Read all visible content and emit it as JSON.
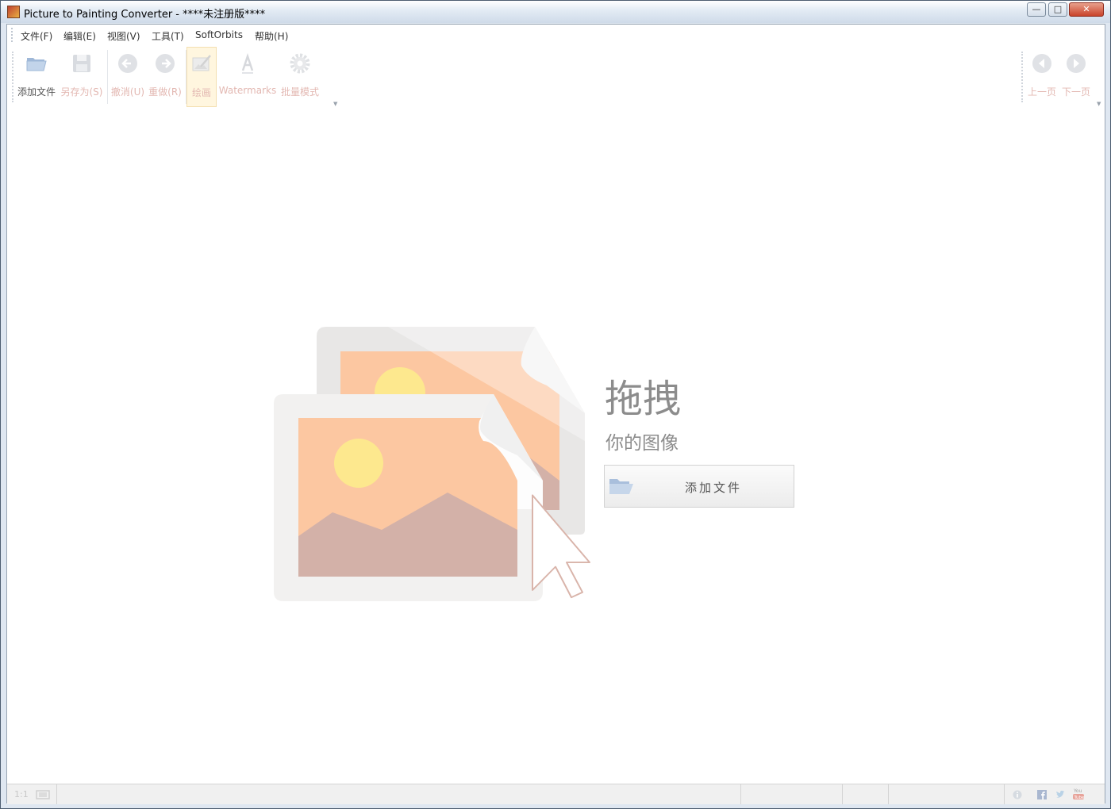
{
  "window": {
    "title": "Picture to Painting Converter - ****未注册版****",
    "buttons": {
      "minimize": "—",
      "maximize": "□",
      "close": "✕"
    }
  },
  "menu": {
    "items": [
      {
        "label": "文件(F)"
      },
      {
        "label": "编辑(E)"
      },
      {
        "label": "视图(V)"
      },
      {
        "label": "工具(T)"
      },
      {
        "label": "SoftOrbits"
      },
      {
        "label": "帮助(H)"
      }
    ]
  },
  "toolbar": {
    "add_file": "添加文件",
    "save_as": "另存为(S)",
    "undo": "撤消(U)",
    "redo": "重做(R)",
    "draw": "绘画",
    "watermarks": "Watermarks",
    "batch_mode": "批量模式",
    "prev_page": "上一页",
    "next_page": "下一页"
  },
  "drop_zone": {
    "title": "拖拽",
    "subtitle": "你的图像",
    "add_file_button": "添加文件"
  },
  "statusbar": {
    "zoom_label": "1:1"
  },
  "colors": {
    "accent_orange": "#fcc7a1",
    "sun_yellow": "#fde88e",
    "mountain": "#d3b1a8",
    "frame_gray": "#f2f1f0",
    "disabled_text": "#e3b8b2"
  }
}
